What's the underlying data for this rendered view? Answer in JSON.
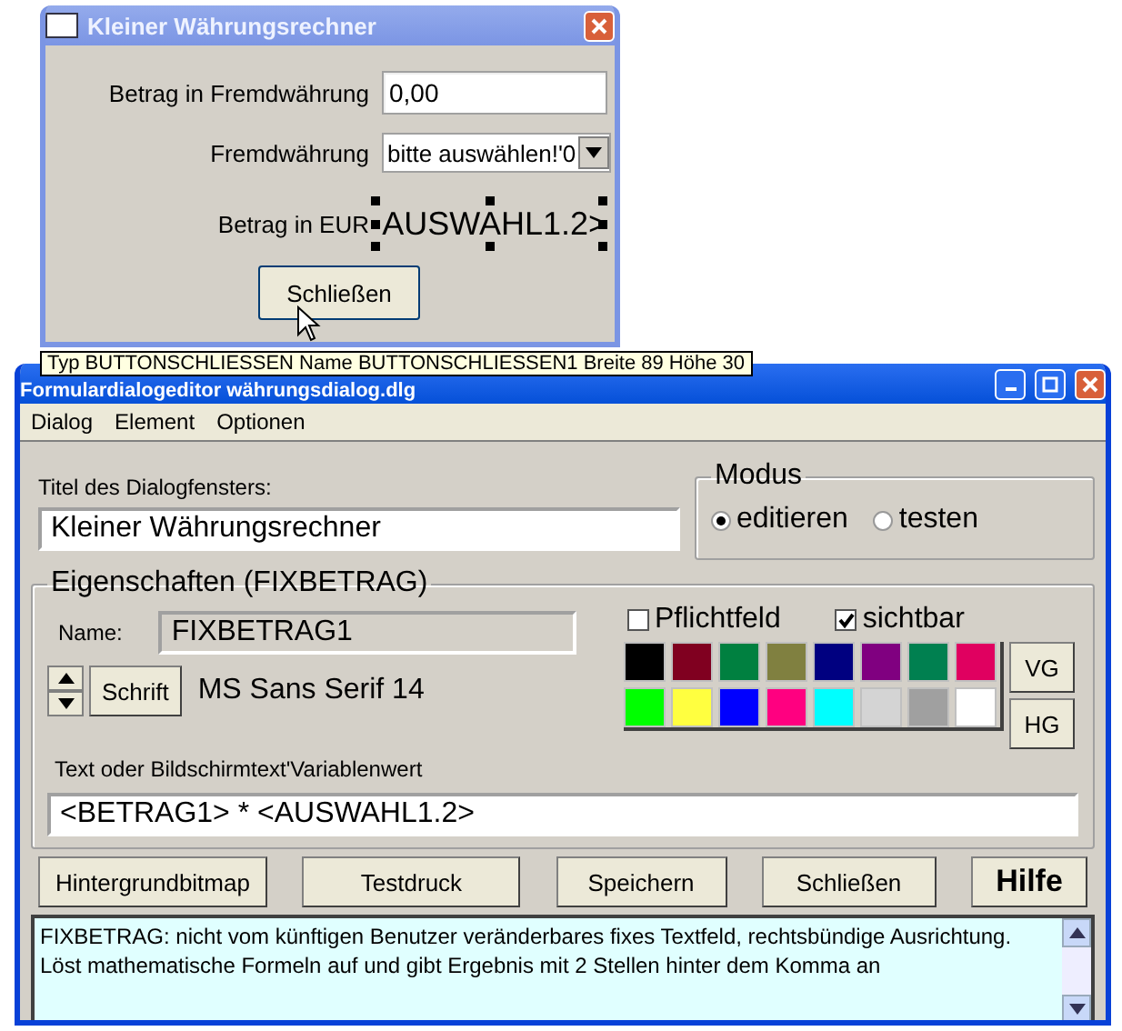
{
  "preview": {
    "title": "Kleiner Währungsrechner",
    "fields": [
      {
        "kind": "input",
        "label": "Betrag in Fremdwährung",
        "value": "0,00"
      },
      {
        "kind": "select",
        "label": "Fremdwährung",
        "value": "bitte auswählen!'0"
      },
      {
        "kind": "fixed",
        "label": "Betrag in EUR",
        "value": "AUSWAHL1.2>"
      }
    ],
    "button": "Schließen"
  },
  "tooltip": "Typ BUTTONSCHLIESSEN Name BUTTONSCHLIESSEN1 Breite 89 Höhe 30",
  "editor": {
    "title": "Formulardialogeditor währungsdialog.dlg",
    "menu": [
      "Dialog",
      "Element",
      "Optionen"
    ],
    "dialog_title_label": "Titel des Dialogfensters:",
    "dialog_title_value": "Kleiner Währungsrechner",
    "mode": {
      "label": "Modus",
      "options": [
        {
          "label": "editieren",
          "selected": true
        },
        {
          "label": "testen",
          "selected": false
        }
      ]
    },
    "properties": {
      "label": "Eigenschaften (FIXBETRAG)",
      "name_label": "Name:",
      "name_value": "FIXBETRAG1",
      "font_button": "Schrift",
      "font": "MS Sans Serif 14",
      "checks": [
        {
          "label": "Pflichtfeld",
          "checked": false
        },
        {
          "label": "sichtbar",
          "checked": true
        }
      ],
      "colors": [
        {
          "color": "#000000"
        },
        {
          "color": "#800020"
        },
        {
          "color": "#008040"
        },
        {
          "color": "#808040"
        },
        {
          "color": "#000080"
        },
        {
          "color": "#800080"
        },
        {
          "color": "#008050"
        },
        {
          "color": "#e00060"
        },
        {
          "color": "#00ff00"
        },
        {
          "color": "#ffff40"
        },
        {
          "color": "#0000ff"
        },
        {
          "color": "#ff0080"
        },
        {
          "color": "#00ffff"
        },
        {
          "color": "#d4d4d4"
        },
        {
          "color": "#a0a0a0"
        },
        {
          "color": "#ffffff"
        }
      ],
      "color_buttons": [
        "VG",
        "HG"
      ],
      "text_label": "Text oder Bildschirmtext'Variablenwert",
      "text_value": "<BETRAG1> * <AUSWAHL1.2>"
    },
    "buttons": [
      {
        "label": "Hintergrundbitmap",
        "kind": "normal"
      },
      {
        "label": "Testdruck",
        "kind": "normal"
      },
      {
        "label": "Speichern",
        "kind": "normal"
      },
      {
        "label": "Schließen",
        "kind": "normal"
      },
      {
        "label": "Hilfe",
        "kind": "bold"
      }
    ],
    "help": "FIXBETRAG: nicht vom künftigen Benutzer veränderbares fixes Textfeld, rechtsbündige Ausrichtung. Löst mathematische Formeln auf und gibt Ergebnis mit 2 Stellen hinter dem Komma an"
  }
}
